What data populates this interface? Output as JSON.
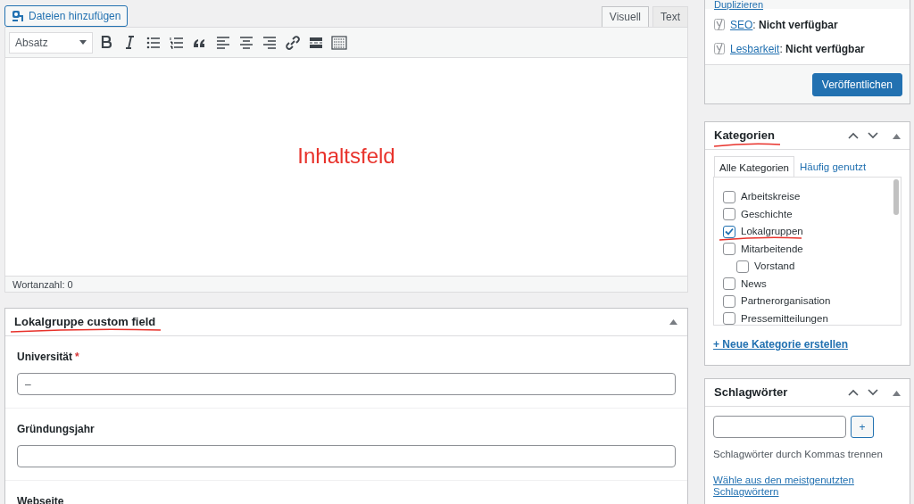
{
  "media_button": {
    "label": "Dateien hinzufügen"
  },
  "editor_tabs": [
    {
      "label": "Visuell",
      "selected": true
    },
    {
      "label": "Text",
      "selected": false
    }
  ],
  "format_select": {
    "value": "Absatz"
  },
  "content_annotation": "Inhaltsfeld",
  "word_count": "Wortanzahl: 0",
  "custom_box": {
    "title": "Lokalgruppe custom field",
    "fields": [
      {
        "label": "Universität",
        "required_mark": "*",
        "value": "–"
      },
      {
        "label": "Gründungsjahr"
      },
      {
        "label": "Webseite"
      }
    ]
  },
  "publish_box": {
    "duplicate_link": "Duplizieren",
    "checks": [
      {
        "link": "SEO",
        "status": ": **Nicht verfügbar**"
      },
      {
        "link": "Lesbarkeit",
        "status": ": **Nicht verfügbar**"
      }
    ],
    "button": "Veröffentlichen"
  },
  "categories_box": {
    "title": "Kategorien",
    "tabs": [
      {
        "label": "Alle Kategorien",
        "selected": true
      },
      {
        "label": "Häufig genutzt",
        "selected": false
      }
    ],
    "items": [
      {
        "label": "Arbeitskreise",
        "checked": false
      },
      {
        "label": "Geschichte",
        "checked": false
      },
      {
        "label": "Lokalgruppen",
        "checked": true
      },
      {
        "label": "Mitarbeitende",
        "checked": false,
        "children": [
          {
            "label": "Vorstand",
            "checked": false
          }
        ]
      },
      {
        "label": "News",
        "checked": false
      },
      {
        "label": "Partnerorganisation",
        "checked": false
      },
      {
        "label": "Pressemitteilungen",
        "checked": false
      }
    ],
    "add_link": "+ Neue Kategorie erstellen"
  },
  "tags_box": {
    "title": "Schlagwörter",
    "add_button": "+",
    "hint": "Schlagwörter durch Kommas trennen",
    "link": "Wähle aus den meistgenutzten Schlagwörtern"
  }
}
